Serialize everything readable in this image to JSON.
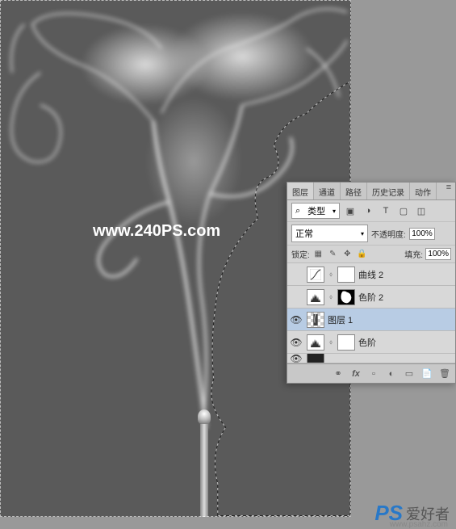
{
  "canvas": {
    "watermark": "www.240PS.com"
  },
  "panel": {
    "tabs": [
      "图层",
      "通道",
      "路径",
      "历史记录",
      "动作"
    ],
    "active_tab": 0,
    "filter": {
      "kind_label": "类型",
      "search_icon": "⌕"
    },
    "type_icons": [
      "▣",
      "◑",
      "T",
      "▢",
      "◫"
    ],
    "blend": {
      "mode": "正常",
      "opacity_label": "不透明度:",
      "opacity_value": "100%"
    },
    "lock": {
      "label": "锁定:",
      "fill_label": "填充:",
      "fill_value": "100%"
    },
    "lock_icons": [
      "▦",
      "✎",
      "✥",
      "🔒"
    ],
    "layers": [
      {
        "visible": false,
        "type": "adjustment",
        "adj_icon": "curves",
        "mask": "white",
        "name": "曲线 2"
      },
      {
        "visible": false,
        "type": "adjustment",
        "adj_icon": "levels",
        "mask": "shape",
        "name": "色阶 2"
      },
      {
        "visible": true,
        "type": "image",
        "thumb": "smoke",
        "name": "图层 1",
        "selected": true
      },
      {
        "visible": true,
        "type": "adjustment",
        "adj_icon": "levels",
        "mask": "white",
        "name": "色阶"
      }
    ],
    "footer_icons": [
      "fx",
      "▫",
      "◐",
      "▭",
      "📄",
      "🗑"
    ]
  },
  "site": {
    "logo": "PS",
    "text": "爱好者",
    "url": "www.psahz.com"
  }
}
